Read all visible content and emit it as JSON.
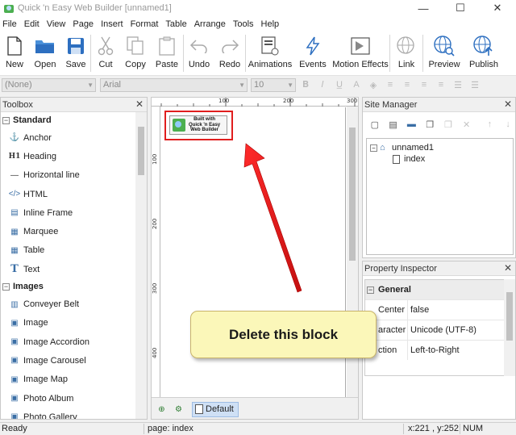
{
  "window": {
    "title": "Quick 'n Easy Web Builder [unnamed1]",
    "minimize": "—",
    "maximize": "☐",
    "close": "✕"
  },
  "menu": [
    "File",
    "Edit",
    "View",
    "Page",
    "Insert",
    "Format",
    "Table",
    "Arrange",
    "Tools",
    "Help"
  ],
  "toolbar": {
    "new": "New",
    "open": "Open",
    "save": "Save",
    "cut": "Cut",
    "copy": "Copy",
    "paste": "Paste",
    "undo": "Undo",
    "redo": "Redo",
    "animations": "Animations",
    "events": "Events",
    "motion_effects": "Motion Effects",
    "link": "Link",
    "preview": "Preview",
    "publish": "Publish"
  },
  "formatbar": {
    "style": "(None)",
    "font": "Arial",
    "size": "10"
  },
  "toolbox": {
    "title": "Toolbox",
    "sections": [
      {
        "name": "Standard",
        "items": [
          "Anchor",
          "Heading",
          "Horizontal line",
          "HTML",
          "Inline Frame",
          "Marquee",
          "Table",
          "Text"
        ]
      },
      {
        "name": "Images",
        "items": [
          "Conveyer Belt",
          "Image",
          "Image Accordion",
          "Image Carousel",
          "Image Map",
          "Photo Album",
          "Photo Gallery"
        ]
      }
    ]
  },
  "canvas": {
    "ruler_h": [
      "100",
      "200",
      "300"
    ],
    "ruler_v": [
      "100",
      "200",
      "300",
      "400"
    ],
    "builtwith_lines": [
      "Built with",
      "Quick 'n Easy",
      "Web Builder"
    ],
    "page_tab": "Default"
  },
  "site_manager": {
    "title": "Site Manager",
    "root": "unnamed1",
    "child": "index"
  },
  "property_inspector": {
    "title": "Property Inspector",
    "group": "General",
    "rows": [
      {
        "key": "Center in Br",
        "value": "false"
      },
      {
        "key": "aracter S",
        "value": "Unicode (UTF-8)"
      },
      {
        "key": "ction",
        "value": "Left-to-Right"
      }
    ]
  },
  "status": {
    "ready": "Ready",
    "page": "page: index",
    "coords": "x:221 , y:252",
    "num": "NUM"
  },
  "callout": {
    "text": "Delete this block"
  },
  "colors": {
    "highlight_red": "#e01e1e",
    "callout_bg": "#fbf7b9",
    "accent_blue": "#3a6ea5"
  }
}
